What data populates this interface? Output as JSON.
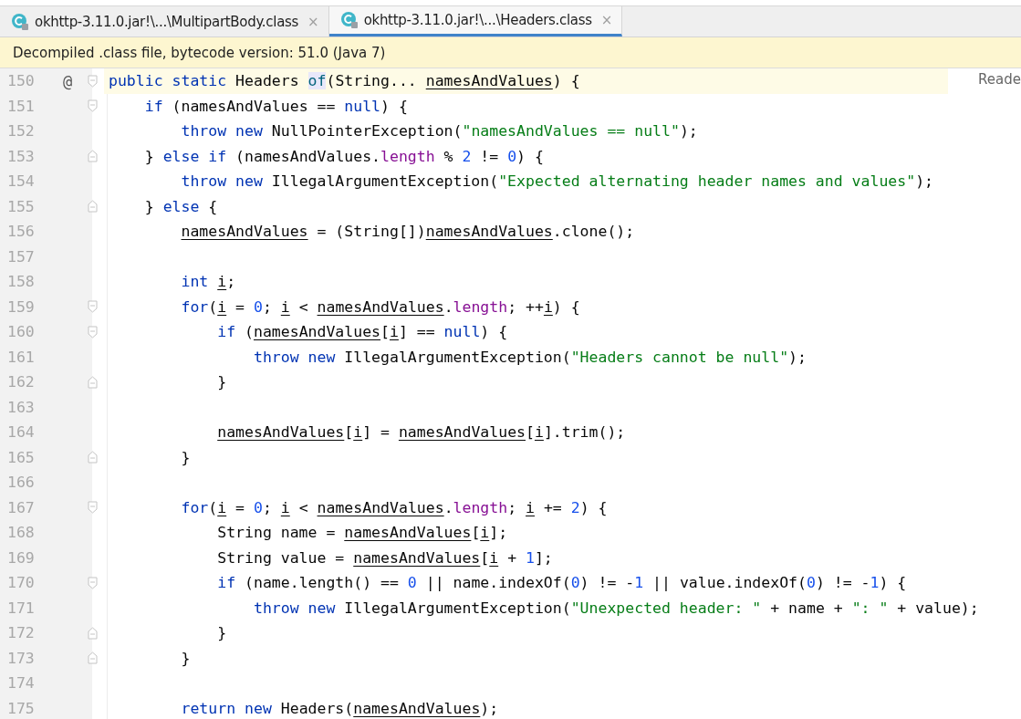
{
  "tabs": [
    {
      "label": "okhttp-3.11.0.jar!\\...\\MultipartBody.class",
      "close": "×",
      "selected": false
    },
    {
      "label": "okhttp-3.11.0.jar!\\...\\Headers.class",
      "close": "×",
      "selected": true
    }
  ],
  "banner": {
    "text": "Decompiled .class file, bytecode version: 51.0 (Java 7)"
  },
  "reader_mode": {
    "label": "Reade"
  },
  "editor": {
    "lines": [
      {
        "number": "150",
        "current": true,
        "gutter_mark": "@",
        "opens_fold": true,
        "closes_fold": false,
        "tokens": [
          {
            "kind": "kw",
            "text": "public"
          },
          {
            "kind": "kw",
            "text": " static"
          },
          {
            "kind": "plain",
            "text": " Headers "
          },
          {
            "kind": "decl",
            "text": "of"
          },
          {
            "kind": "plain",
            "text": "(String... "
          },
          {
            "kind": "var",
            "text": "namesAndValues"
          },
          {
            "kind": "plain",
            "text": ") {"
          }
        ]
      },
      {
        "number": "151",
        "current": false,
        "opens_fold": true,
        "closes_fold": false,
        "tokens": [
          {
            "kind": "kw",
            "text": "    if"
          },
          {
            "kind": "plain",
            "text": " (namesAndValues == "
          },
          {
            "kind": "kw",
            "text": "null"
          },
          {
            "kind": "plain",
            "text": ") {"
          }
        ]
      },
      {
        "number": "152",
        "current": false,
        "opens_fold": false,
        "closes_fold": false,
        "tokens": [
          {
            "kind": "kw",
            "text": "        throw new"
          },
          {
            "kind": "plain",
            "text": " NullPointerException("
          },
          {
            "kind": "str",
            "text": "\"namesAndValues == null\""
          },
          {
            "kind": "plain",
            "text": ");"
          }
        ]
      },
      {
        "number": "153",
        "current": false,
        "opens_fold": false,
        "closes_fold": true,
        "tokens": [
          {
            "kind": "plain",
            "text": "    } "
          },
          {
            "kind": "kw",
            "text": "else if"
          },
          {
            "kind": "plain",
            "text": " (namesAndValues."
          },
          {
            "kind": "field",
            "text": "length"
          },
          {
            "kind": "plain",
            "text": " % "
          },
          {
            "kind": "num",
            "text": "2"
          },
          {
            "kind": "plain",
            "text": " != "
          },
          {
            "kind": "num",
            "text": "0"
          },
          {
            "kind": "plain",
            "text": ") {"
          }
        ]
      },
      {
        "number": "154",
        "current": false,
        "opens_fold": false,
        "closes_fold": false,
        "tokens": [
          {
            "kind": "kw",
            "text": "        throw new"
          },
          {
            "kind": "plain",
            "text": " IllegalArgumentException("
          },
          {
            "kind": "str",
            "text": "\"Expected alternating header names and values\""
          },
          {
            "kind": "plain",
            "text": ");"
          }
        ]
      },
      {
        "number": "155",
        "current": false,
        "opens_fold": false,
        "closes_fold": true,
        "tokens": [
          {
            "kind": "plain",
            "text": "    } "
          },
          {
            "kind": "kw",
            "text": "else"
          },
          {
            "kind": "plain",
            "text": " {"
          }
        ]
      },
      {
        "number": "156",
        "current": false,
        "opens_fold": false,
        "closes_fold": false,
        "tokens": [
          {
            "kind": "var",
            "text": "        namesAndValues"
          },
          {
            "kind": "plain",
            "text": " = (String[])"
          },
          {
            "kind": "var",
            "text": "namesAndValues"
          },
          {
            "kind": "plain",
            "text": ".clone();"
          }
        ]
      },
      {
        "number": "157",
        "current": false,
        "opens_fold": false,
        "closes_fold": false
      },
      {
        "number": "158",
        "current": false,
        "opens_fold": false,
        "closes_fold": false,
        "tokens": [
          {
            "kind": "kw",
            "text": "        int"
          },
          {
            "kind": "var",
            "text": " i"
          },
          {
            "kind": "plain",
            "text": ";"
          }
        ]
      },
      {
        "number": "159",
        "current": false,
        "opens_fold": true,
        "closes_fold": false,
        "tokens": [
          {
            "kind": "kw",
            "text": "        for"
          },
          {
            "kind": "plain",
            "text": "("
          },
          {
            "kind": "var",
            "text": "i"
          },
          {
            "kind": "plain",
            "text": " = "
          },
          {
            "kind": "num",
            "text": "0"
          },
          {
            "kind": "plain",
            "text": "; "
          },
          {
            "kind": "var",
            "text": "i"
          },
          {
            "kind": "plain",
            "text": " < "
          },
          {
            "kind": "var",
            "text": "namesAndValues"
          },
          {
            "kind": "plain",
            "text": "."
          },
          {
            "kind": "field",
            "text": "length"
          },
          {
            "kind": "plain",
            "text": "; ++"
          },
          {
            "kind": "var",
            "text": "i"
          },
          {
            "kind": "plain",
            "text": ") {"
          }
        ]
      },
      {
        "number": "160",
        "current": false,
        "opens_fold": true,
        "closes_fold": false,
        "tokens": [
          {
            "kind": "kw",
            "text": "            if"
          },
          {
            "kind": "plain",
            "text": " ("
          },
          {
            "kind": "var",
            "text": "namesAndValues"
          },
          {
            "kind": "plain",
            "text": "["
          },
          {
            "kind": "var",
            "text": "i"
          },
          {
            "kind": "plain",
            "text": "] == "
          },
          {
            "kind": "kw",
            "text": "null"
          },
          {
            "kind": "plain",
            "text": ") {"
          }
        ]
      },
      {
        "number": "161",
        "current": false,
        "opens_fold": false,
        "closes_fold": false,
        "tokens": [
          {
            "kind": "kw",
            "text": "                throw new"
          },
          {
            "kind": "plain",
            "text": " IllegalArgumentException("
          },
          {
            "kind": "str",
            "text": "\"Headers cannot be null\""
          },
          {
            "kind": "plain",
            "text": ");"
          }
        ]
      },
      {
        "number": "162",
        "current": false,
        "opens_fold": false,
        "closes_fold": true,
        "tokens": [
          {
            "kind": "plain",
            "text": "            }"
          }
        ]
      },
      {
        "number": "163",
        "current": false,
        "opens_fold": false,
        "closes_fold": false
      },
      {
        "number": "164",
        "current": false,
        "opens_fold": false,
        "closes_fold": false,
        "tokens": [
          {
            "kind": "var",
            "text": "            namesAndValues"
          },
          {
            "kind": "plain",
            "text": "["
          },
          {
            "kind": "var",
            "text": "i"
          },
          {
            "kind": "plain",
            "text": "] = "
          },
          {
            "kind": "var",
            "text": "namesAndValues"
          },
          {
            "kind": "plain",
            "text": "["
          },
          {
            "kind": "var",
            "text": "i"
          },
          {
            "kind": "plain",
            "text": "].trim();"
          }
        ]
      },
      {
        "number": "165",
        "current": false,
        "opens_fold": false,
        "closes_fold": true,
        "tokens": [
          {
            "kind": "plain",
            "text": "        }"
          }
        ]
      },
      {
        "number": "166",
        "current": false,
        "opens_fold": false,
        "closes_fold": false
      },
      {
        "number": "167",
        "current": false,
        "opens_fold": true,
        "closes_fold": false,
        "tokens": [
          {
            "kind": "kw",
            "text": "        for"
          },
          {
            "kind": "plain",
            "text": "("
          },
          {
            "kind": "var",
            "text": "i"
          },
          {
            "kind": "plain",
            "text": " = "
          },
          {
            "kind": "num",
            "text": "0"
          },
          {
            "kind": "plain",
            "text": "; "
          },
          {
            "kind": "var",
            "text": "i"
          },
          {
            "kind": "plain",
            "text": " < "
          },
          {
            "kind": "var",
            "text": "namesAndValues"
          },
          {
            "kind": "plain",
            "text": "."
          },
          {
            "kind": "field",
            "text": "length"
          },
          {
            "kind": "plain",
            "text": "; "
          },
          {
            "kind": "var",
            "text": "i"
          },
          {
            "kind": "plain",
            "text": " += "
          },
          {
            "kind": "num",
            "text": "2"
          },
          {
            "kind": "plain",
            "text": ") {"
          }
        ]
      },
      {
        "number": "168",
        "current": false,
        "opens_fold": false,
        "closes_fold": false,
        "tokens": [
          {
            "kind": "plain",
            "text": "            String name = "
          },
          {
            "kind": "var",
            "text": "namesAndValues"
          },
          {
            "kind": "plain",
            "text": "["
          },
          {
            "kind": "var",
            "text": "i"
          },
          {
            "kind": "plain",
            "text": "];"
          }
        ]
      },
      {
        "number": "169",
        "current": false,
        "opens_fold": false,
        "closes_fold": false,
        "tokens": [
          {
            "kind": "plain",
            "text": "            String value = "
          },
          {
            "kind": "var",
            "text": "namesAndValues"
          },
          {
            "kind": "plain",
            "text": "["
          },
          {
            "kind": "var",
            "text": "i"
          },
          {
            "kind": "plain",
            "text": " + "
          },
          {
            "kind": "num",
            "text": "1"
          },
          {
            "kind": "plain",
            "text": "];"
          }
        ]
      },
      {
        "number": "170",
        "current": false,
        "opens_fold": true,
        "closes_fold": false,
        "tokens": [
          {
            "kind": "kw",
            "text": "            if"
          },
          {
            "kind": "plain",
            "text": " (name.length() == "
          },
          {
            "kind": "num",
            "text": "0"
          },
          {
            "kind": "plain",
            "text": " || name.indexOf("
          },
          {
            "kind": "num",
            "text": "0"
          },
          {
            "kind": "plain",
            "text": ") != -"
          },
          {
            "kind": "num",
            "text": "1"
          },
          {
            "kind": "plain",
            "text": " || value.indexOf("
          },
          {
            "kind": "num",
            "text": "0"
          },
          {
            "kind": "plain",
            "text": ") != -"
          },
          {
            "kind": "num",
            "text": "1"
          },
          {
            "kind": "plain",
            "text": ") {"
          }
        ]
      },
      {
        "number": "171",
        "current": false,
        "opens_fold": false,
        "closes_fold": false,
        "tokens": [
          {
            "kind": "kw",
            "text": "                throw new"
          },
          {
            "kind": "plain",
            "text": " IllegalArgumentException("
          },
          {
            "kind": "str",
            "text": "\"Unexpected header: \""
          },
          {
            "kind": "plain",
            "text": " + name + "
          },
          {
            "kind": "str",
            "text": "\": \""
          },
          {
            "kind": "plain",
            "text": " + value);"
          }
        ]
      },
      {
        "number": "172",
        "current": false,
        "opens_fold": false,
        "closes_fold": true,
        "tokens": [
          {
            "kind": "plain",
            "text": "            }"
          }
        ]
      },
      {
        "number": "173",
        "current": false,
        "opens_fold": false,
        "closes_fold": true,
        "tokens": [
          {
            "kind": "plain",
            "text": "        }"
          }
        ]
      },
      {
        "number": "174",
        "current": false,
        "opens_fold": false,
        "closes_fold": false
      },
      {
        "number": "175",
        "current": false,
        "opens_fold": false,
        "closes_fold": false,
        "tokens": [
          {
            "kind": "kw",
            "text": "        return new"
          },
          {
            "kind": "plain",
            "text": " Headers("
          },
          {
            "kind": "var",
            "text": "namesAndValues"
          },
          {
            "kind": "plain",
            "text": ");"
          }
        ]
      }
    ]
  }
}
